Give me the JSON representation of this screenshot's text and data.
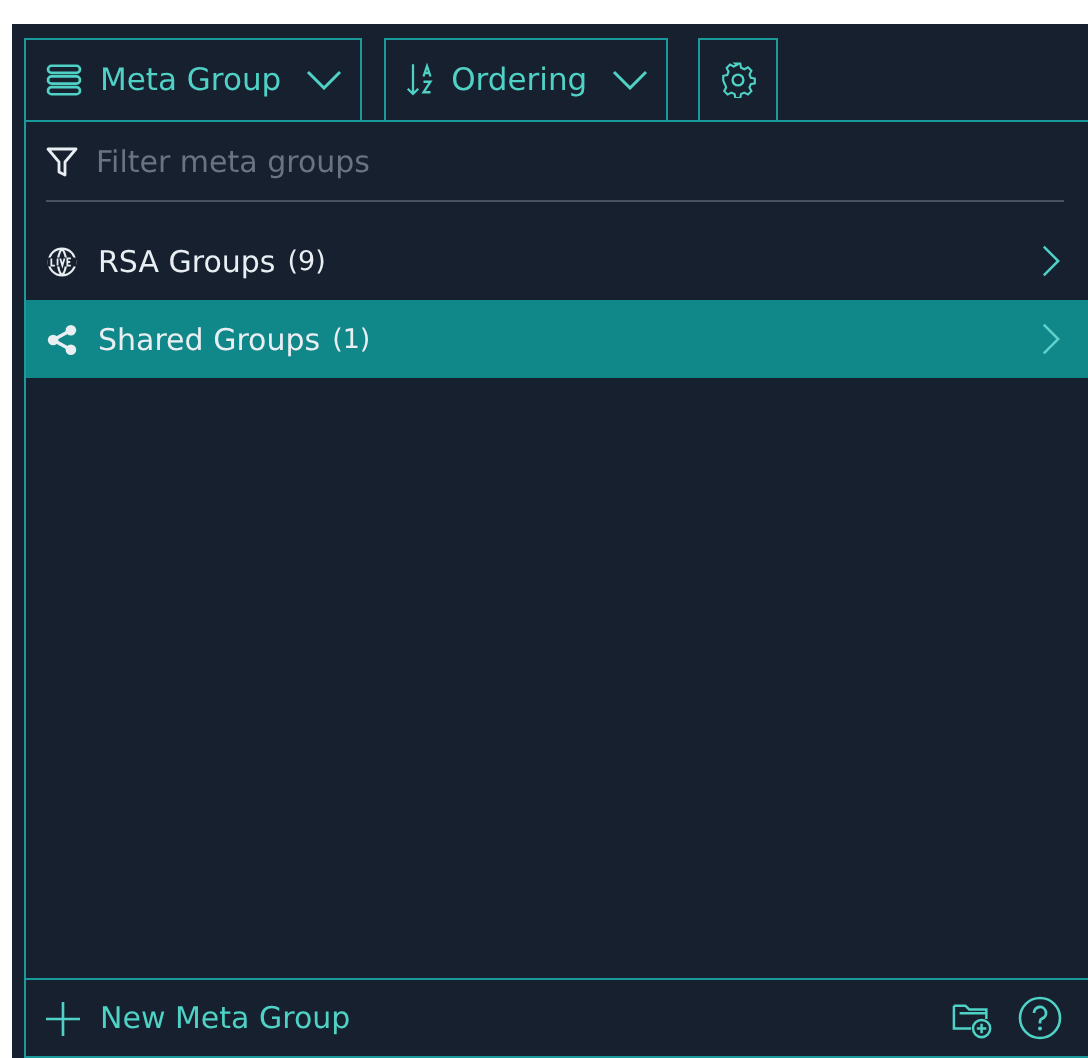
{
  "toolbar": {
    "meta_group_button": {
      "label": "Meta Group"
    },
    "ordering_button": {
      "label": "Ordering"
    }
  },
  "filter": {
    "placeholder": "Filter meta groups"
  },
  "items": [
    {
      "label": "RSA Groups",
      "count": "(9)",
      "kind": "live",
      "selected": false
    },
    {
      "label": "Shared Groups",
      "count": "(1)",
      "kind": "share",
      "selected": true
    }
  ],
  "footer": {
    "new_button": {
      "label": "New Meta Group"
    }
  }
}
